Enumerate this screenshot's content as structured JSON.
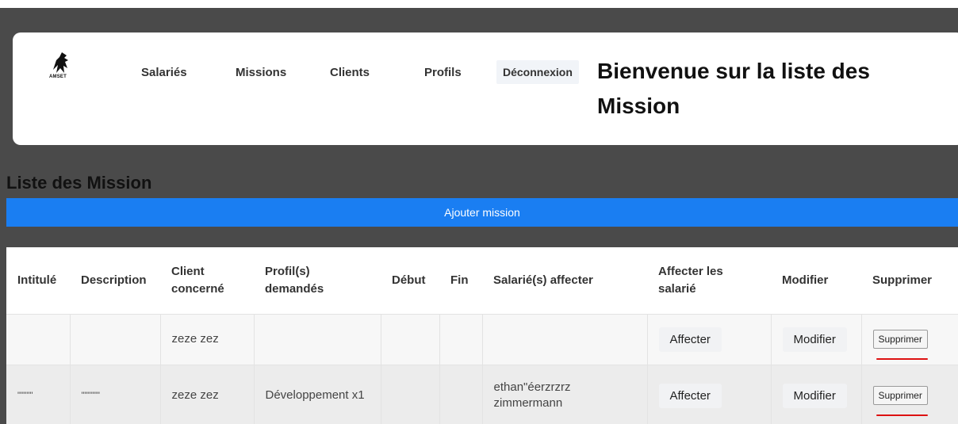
{
  "logo": {
    "text": "AMSET"
  },
  "nav": [
    {
      "label": "Salariés"
    },
    {
      "label": "Missions"
    },
    {
      "label": "Clients"
    },
    {
      "label": "Profils"
    }
  ],
  "logout_label": "Déconnexion",
  "welcome_title": "Bienvenue sur la liste des Mission",
  "list_title": "Liste des Mission",
  "add_button_label": "Ajouter mission",
  "table": {
    "headers": [
      "Intitulé",
      "Description",
      "Client concerné",
      "Profil(s) demandés",
      "Début",
      "Fin",
      "Salarié(s) affecter",
      "Affecter les salarié",
      "Modifier",
      "Supprimer"
    ],
    "rows": [
      {
        "intitule": "",
        "description": "",
        "client": "zeze zez",
        "profils": "",
        "debut": "",
        "fin": "",
        "salaries": "",
        "affecter_label": "Affecter",
        "modifier_label": "Modifier",
        "supprimer_label": "Supprimer"
      },
      {
        "intitule": "\"\"\"\"\"",
        "description": "\"\"\"\"\"\"",
        "client": "zeze zez",
        "profils": "Développement x1",
        "debut": "",
        "fin": "",
        "salaries": "ethan\"éerzrzrz zimmermann",
        "affecter_label": "Affecter",
        "modifier_label": "Modifier",
        "supprimer_label": "Supprimer"
      }
    ]
  },
  "colors": {
    "background": "#4a4a4a",
    "accent_blue": "#1a7ef2",
    "annotation_red": "#dd1111"
  }
}
